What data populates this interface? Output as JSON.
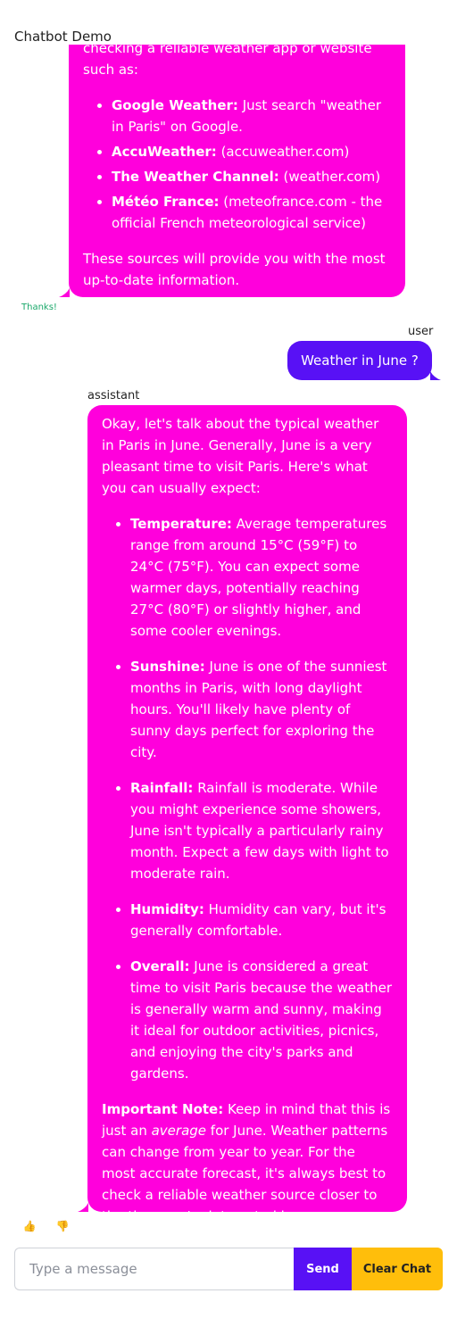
{
  "app": {
    "title": "Chatbot Demo"
  },
  "colors": {
    "assistant_bubble": "#ff00dc",
    "user_bubble": "#5811f5",
    "send_button": "#5811f5",
    "clear_button": "#ffbe0b",
    "suggestion_text": "#1aa86a"
  },
  "messages": {
    "prev_assistant": {
      "intro_partial": "checking a reliable weather app or website such as:",
      "sources": [
        {
          "name": "Google Weather:",
          "detail": " Just search \"weather in Paris\" on Google."
        },
        {
          "name": "AccuWeather:",
          "detail": " (accuweather.com)"
        },
        {
          "name": "The Weather Channel:",
          "detail": " (weather.com)"
        },
        {
          "name": "Météo France:",
          "detail": " (meteofrance.com - the official French meteorological service)"
        }
      ],
      "outro": "These sources will provide you with the most up-to-date information."
    },
    "suggestion": "Thanks!",
    "user": {
      "role": "user",
      "text": "Weather in June ?"
    },
    "assistant": {
      "role": "assistant",
      "intro": "Okay, let's talk about the typical weather in Paris in June. Generally, June is a very pleasant time to visit Paris. Here's what you can usually expect:",
      "items": [
        {
          "title": "Temperature:",
          "text": " Average temperatures range from around 15°C (59°F) to 24°C (75°F). You can expect some warmer days, potentially reaching 27°C (80°F) or slightly higher, and some cooler evenings."
        },
        {
          "title": "Sunshine:",
          "text": " June is one of the sunniest months in Paris, with long daylight hours. You'll likely have plenty of sunny days perfect for exploring the city."
        },
        {
          "title": "Rainfall:",
          "text": " Rainfall is moderate. While you might experience some showers, June isn't typically a particularly rainy month. Expect a few days with light to moderate rain."
        },
        {
          "title": "Humidity:",
          "text": " Humidity can vary, but it's generally comfortable."
        },
        {
          "title": "Overall:",
          "text": " June is considered a great time to visit Paris because the weather is generally warm and sunny, making it ideal for outdoor activities, picnics, and enjoying the city's parks and gardens."
        }
      ],
      "note": {
        "label": "Important Note:",
        "text_a": " Keep in mind that this is just an ",
        "emphasis": "average",
        "text_b": " for June. Weather patterns can change from year to year. For the most accurate forecast, it's always best to check a reliable weather source closer to the time you're interested in."
      }
    }
  },
  "feedback": {
    "like_icon": "thumbs-up-icon",
    "dislike_icon": "thumbs-down-icon",
    "like_glyph": "👍",
    "dislike_glyph": "👎"
  },
  "composer": {
    "placeholder": "Type a message",
    "send_label": "Send",
    "clear_label": "Clear Chat"
  }
}
